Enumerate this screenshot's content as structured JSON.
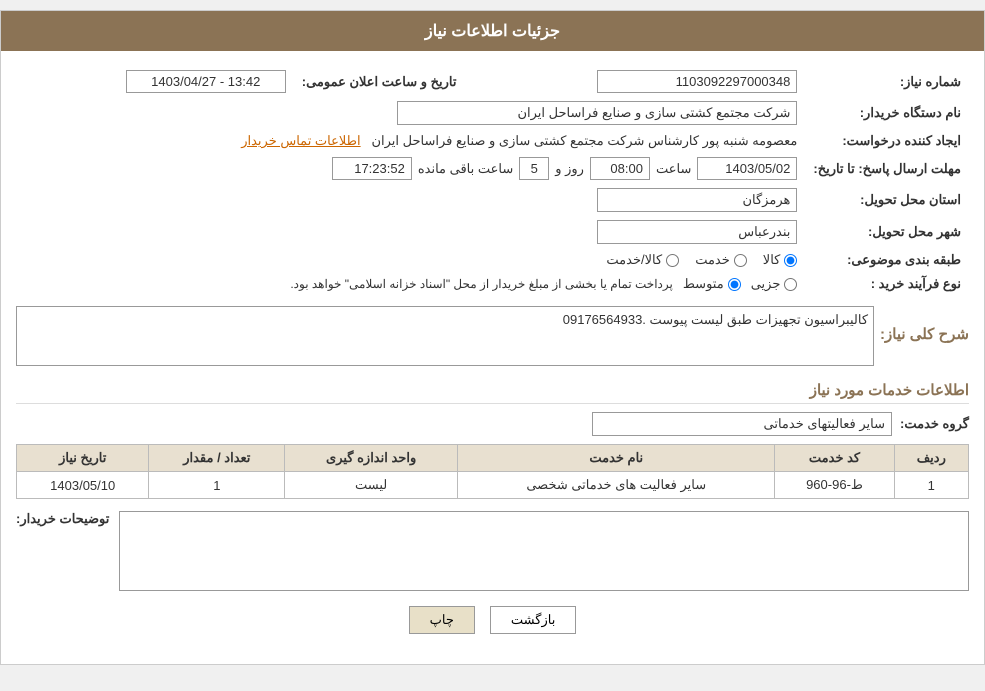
{
  "header": {
    "title": "جزئیات اطلاعات نیاز"
  },
  "main": {
    "need_number_label": "شماره نیاز:",
    "need_number_value": "1103092297000348",
    "buyer_org_label": "نام دستگاه خریدار:",
    "buyer_org_value": "شرکت مجتمع کشتی سازی و صنایع فراساحل ایران",
    "requester_label": "ایجاد کننده درخواست:",
    "requester_value": "معصومه شنبه پور کارشناس شرکت مجتمع کشتی سازی و صنایع فراساحل ایران",
    "requester_link": "اطلاعات تماس خریدار",
    "announce_datetime_label": "تاریخ و ساعت اعلان عمومی:",
    "announce_datetime_value": "1403/04/27 - 13:42",
    "response_deadline_label": "مهلت ارسال پاسخ: تا تاریخ:",
    "response_date_value": "1403/05/02",
    "response_time_label": "ساعت",
    "response_time_value": "08:00",
    "response_day_label": "روز و",
    "response_days_value": "5",
    "response_remaining_label": "ساعت باقی مانده",
    "response_remaining_value": "17:23:52",
    "province_label": "استان محل تحویل:",
    "province_value": "هرمزگان",
    "city_label": "شهر محل تحویل:",
    "city_value": "بندرعباس",
    "classification_label": "طبقه بندی موضوعی:",
    "classification_options": [
      "کالا",
      "خدمت",
      "کالا/خدمت"
    ],
    "classification_selected": "کالا",
    "process_label": "نوع فرآیند خرید :",
    "process_options": [
      "جزیی",
      "متوسط"
    ],
    "process_selected": "متوسط",
    "process_note": "پرداخت تمام یا بخشی از مبلغ خریدار از محل \"اسناد خزانه اسلامی\" خواهد بود.",
    "description_section_title": "شرح کلی نیاز:",
    "description_value": "کالیبراسیون تجهیزات طبق لیست پیوست .09176564933",
    "services_section_title": "اطلاعات خدمات مورد نیاز",
    "service_group_label": "گروه خدمت:",
    "service_group_value": "سایر فعالیتهای خدماتی",
    "services_table": {
      "headers": [
        "ردیف",
        "کد خدمت",
        "نام خدمت",
        "واحد اندازه گیری",
        "تعداد / مقدار",
        "تاریخ نیاز"
      ],
      "rows": [
        {
          "row": "1",
          "code": "ط-96-960",
          "name": "سایر فعالیت های خدماتی شخصی",
          "unit": "لیست",
          "quantity": "1",
          "date": "1403/05/10"
        }
      ]
    },
    "buyer_desc_label": "توضیحات خریدار:",
    "back_button": "بازگشت",
    "print_button": "چاپ"
  }
}
